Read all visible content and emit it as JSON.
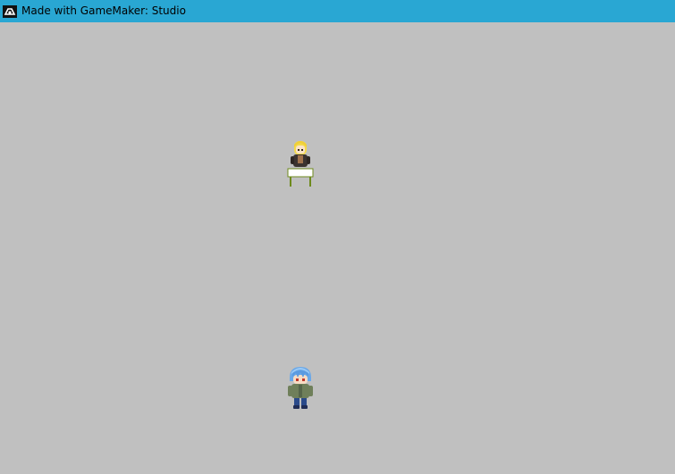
{
  "window": {
    "title": "Made with GameMaker: Studio",
    "titlebar_color": "#29a7d3",
    "room_color": "#c0c0c0"
  },
  "scene": {
    "npc": {
      "name": "blonde-girl-npc",
      "object": "sign-table"
    },
    "player": {
      "name": "blue-haired-player"
    }
  },
  "icons": {
    "app_logo": "gamemaker-logo-icon"
  }
}
